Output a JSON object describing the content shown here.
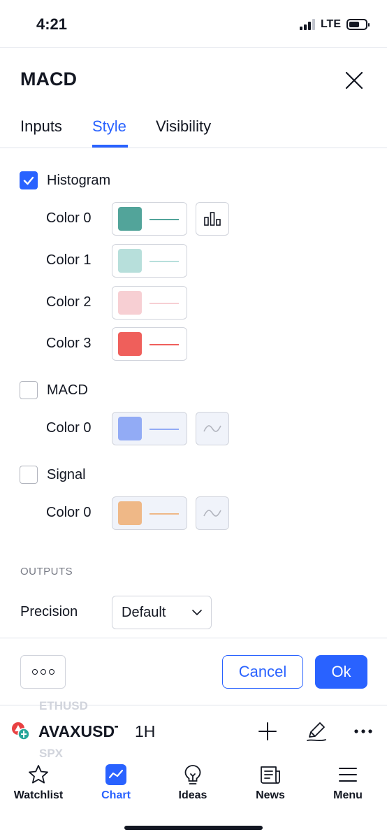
{
  "status_bar": {
    "time": "4:21",
    "network": "LTE"
  },
  "dialog": {
    "title": "MACD",
    "tabs": [
      {
        "label": "Inputs",
        "active": false
      },
      {
        "label": "Style",
        "active": true
      },
      {
        "label": "Visibility",
        "active": false
      }
    ],
    "histogram": {
      "label": "Histogram",
      "checked": true,
      "colors": [
        {
          "label": "Color 0",
          "color": "#52a49a"
        },
        {
          "label": "Color 1",
          "color": "#b7dfdb"
        },
        {
          "label": "Color 2",
          "color": "#f7cfd3"
        },
        {
          "label": "Color 3",
          "color": "#ef5f5b"
        }
      ],
      "style_icon": "histogram-columns-icon"
    },
    "macd": {
      "label": "MACD",
      "checked": false,
      "colors": [
        {
          "label": "Color 0",
          "color": "#92abf5"
        }
      ],
      "style_icon": "line-style-icon"
    },
    "signal": {
      "label": "Signal",
      "checked": false,
      "colors": [
        {
          "label": "Color 0",
          "color": "#efb887"
        }
      ],
      "style_icon": "line-style-icon"
    },
    "outputs": {
      "heading": "OUTPUTS",
      "precision_label": "Precision",
      "precision_value": "Default"
    },
    "footer": {
      "more_icon": "more-options-icon",
      "cancel_label": "Cancel",
      "ok_label": "Ok"
    }
  },
  "chart_toolbar": {
    "ghost_above": "ETHUSD",
    "symbol": "AVAXUSDT",
    "ghost_below": "SPX",
    "interval": "1H",
    "tools": [
      "add-icon",
      "drawing-pen-icon",
      "more-icon"
    ]
  },
  "bottom_nav": {
    "items": [
      {
        "label": "Watchlist",
        "icon": "star-icon",
        "active": false
      },
      {
        "label": "Chart",
        "icon": "chart-icon",
        "active": true
      },
      {
        "label": "Ideas",
        "icon": "lightbulb-icon",
        "active": false
      },
      {
        "label": "News",
        "icon": "news-icon",
        "active": false
      },
      {
        "label": "Menu",
        "icon": "menu-icon",
        "active": false
      }
    ]
  },
  "colors": {
    "accent": "#2962ff",
    "text": "#131722",
    "border": "#d1d4dc",
    "muted": "#787b86"
  }
}
